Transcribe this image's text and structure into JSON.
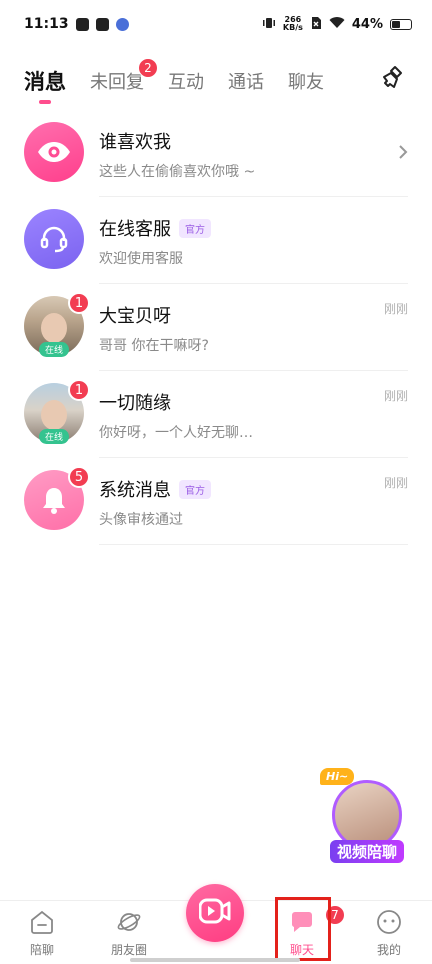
{
  "status_bar": {
    "time": "11:13",
    "net_speed_value": "266",
    "net_speed_unit": "KB/s",
    "battery": "44%"
  },
  "tabs": [
    {
      "label": "消息",
      "active": true,
      "badge": ""
    },
    {
      "label": "未回复",
      "active": false,
      "badge": "2"
    },
    {
      "label": "互动",
      "active": false,
      "badge": ""
    },
    {
      "label": "通话",
      "active": false,
      "badge": ""
    },
    {
      "label": "聊友",
      "active": false,
      "badge": ""
    }
  ],
  "conversations": [
    {
      "name": "谁喜欢我",
      "subtitle": "这些人在偷偷喜欢你哦 ~",
      "time": "",
      "official_tag": "",
      "badge": "",
      "online": ""
    },
    {
      "name": "在线客服",
      "subtitle": "欢迎使用客服",
      "time": "",
      "official_tag": "官方",
      "badge": "",
      "online": ""
    },
    {
      "name": "大宝贝呀",
      "subtitle": "哥哥 你在干嘛呀?",
      "time": "刚刚",
      "official_tag": "",
      "badge": "1",
      "online": "在线"
    },
    {
      "name": "一切随缘",
      "subtitle": "你好呀，一个人好无聊…",
      "time": "刚刚",
      "official_tag": "",
      "badge": "1",
      "online": "在线"
    },
    {
      "name": "系统消息",
      "subtitle": "头像审核通过",
      "time": "刚刚",
      "official_tag": "官方",
      "badge": "5",
      "online": ""
    }
  ],
  "floating": {
    "hi": "Hi~",
    "label": "视频陪聊"
  },
  "bottom_nav": {
    "items": [
      {
        "label": "陪聊"
      },
      {
        "label": "朋友圈"
      },
      {
        "label": "聊天",
        "badge": "7"
      },
      {
        "label": "我的"
      }
    ]
  },
  "colors": {
    "accent": "#ff4d8d",
    "badge": "#f23d52",
    "online": "#34c38f",
    "official": "#9b5de5",
    "highlight": "#e3211b"
  }
}
